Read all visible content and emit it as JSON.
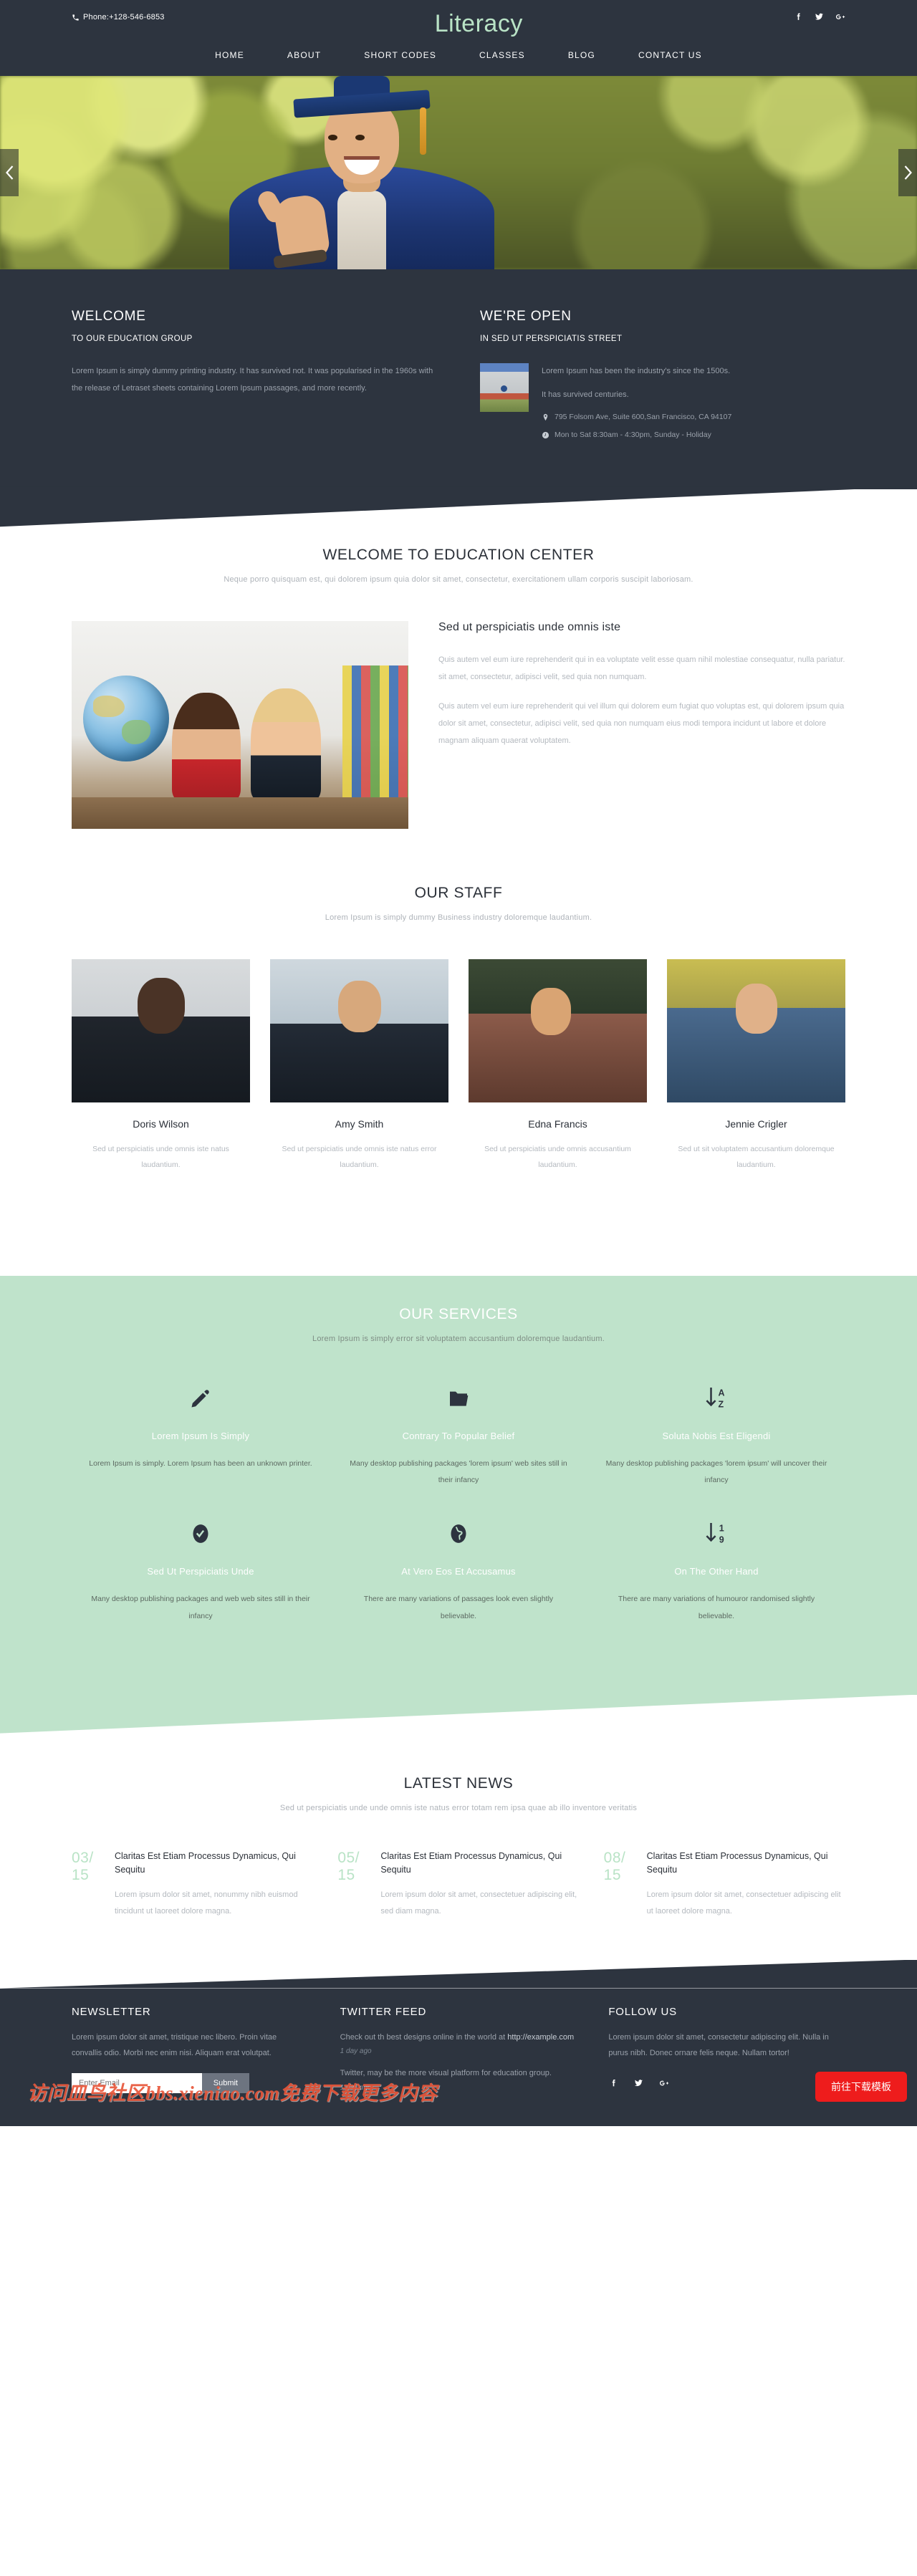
{
  "header": {
    "phone": "Phone:+128-546-6853",
    "phone_icon": "phone-icon",
    "brand": "Literacy",
    "social": [
      {
        "icon": "facebook-icon",
        "label": "Facebook"
      },
      {
        "icon": "twitter-icon",
        "label": "Twitter"
      },
      {
        "icon": "google-plus-icon",
        "label": "Google Plus"
      }
    ],
    "nav": [
      {
        "label": "HOME"
      },
      {
        "label": "ABOUT"
      },
      {
        "label": "SHORT CODES"
      },
      {
        "label": "CLASSES"
      },
      {
        "label": "BLOG"
      },
      {
        "label": "CONTACT US"
      }
    ]
  },
  "hero": {
    "prev_icon": "chevron-left-icon",
    "next_icon": "chevron-right-icon"
  },
  "welcome_band": {
    "left": {
      "title": "WELCOME",
      "subtitle": "TO OUR EDUCATION GROUP",
      "body": "Lorem Ipsum is simply dummy printing industry. It has survived not. It was popularised in the 1960s with the release of Letraset sheets containing Lorem Ipsum passages, and more recently."
    },
    "right": {
      "title": "WE'RE OPEN",
      "subtitle": "IN SED UT PERSPICIATIS STREET",
      "body1": "Lorem Ipsum has been the industry's since the 1500s.",
      "body2": "It has survived centuries.",
      "address_icon": "map-pin-icon",
      "address": "795 Folsom Ave, Suite 600,San Francisco, CA 94107",
      "hours_icon": "clock-icon",
      "hours": "Mon to Sat 8:30am - 4:30pm, Sunday - Holiday"
    }
  },
  "education": {
    "title": "WELCOME TO EDUCATION CENTER",
    "subtitle": "Neque porro quisquam est, qui dolorem ipsum quia dolor sit amet, consectetur, exercitationem ullam corporis suscipit laboriosam.",
    "heading": "Sed ut perspiciatis unde omnis iste",
    "p1": "Quis autem vel eum iure reprehenderit qui in ea voluptate velit esse quam nihil molestiae consequatur, nulla pariatur. sit amet, consectetur, adipisci velit, sed quia non numquam.",
    "p2": "Quis autem vel eum iure reprehenderit qui vel illum qui dolorem eum fugiat quo voluptas est, qui dolorem ipsum quia dolor sit amet, consectetur, adipisci velit, sed quia non numquam eius modi tempora incidunt ut labore et dolore magnam aliquam quaerat voluptatem."
  },
  "staff": {
    "title": "OUR STAFF",
    "subtitle": "Lorem Ipsum is simply dummy Business industry doloremque laudantium.",
    "members": [
      {
        "name": "Doris Wilson",
        "desc": "Sed ut perspiciatis unde omnis iste natus laudantium."
      },
      {
        "name": "Amy Smith",
        "desc": "Sed ut perspiciatis unde omnis iste natus error laudantium."
      },
      {
        "name": "Edna Francis",
        "desc": "Sed ut perspiciatis unde omnis accusantium laudantium."
      },
      {
        "name": "Jennie Crigler",
        "desc": "Sed ut sit voluptatem accusantium doloremque laudantium."
      }
    ]
  },
  "services": {
    "title": "OUR SERVICES",
    "subtitle": "Lorem Ipsum is simply error sit voluptatem accusantium doloremque laudantium.",
    "items": [
      {
        "icon": "pencil-icon",
        "title": "Lorem Ipsum Is Simply",
        "desc": "Lorem Ipsum is simply. Lorem Ipsum has been an unknown printer."
      },
      {
        "icon": "folder-icon",
        "title": "Contrary To Popular Belief",
        "desc": "Many desktop publishing packages 'lorem ipsum' web sites still in their infancy"
      },
      {
        "icon": "sort-alpha-desc-icon",
        "title": "Soluta Nobis Est Eligendi",
        "desc": "Many desktop publishing packages 'lorem ipsum' will uncover their infancy"
      },
      {
        "icon": "check-badge-icon",
        "title": "Sed Ut Perspiciatis Unde",
        "desc": "Many desktop publishing packages and web web sites still in their infancy"
      },
      {
        "icon": "globe-icon",
        "title": "At Vero Eos Et Accusamus",
        "desc": "There are many variations of passages look even slightly believable."
      },
      {
        "icon": "sort-numeric-desc-icon",
        "title": "On The Other Hand",
        "desc": "There are many variations of humouror randomised slightly believable."
      }
    ]
  },
  "news": {
    "title": "LATEST NEWS",
    "subtitle": "Sed ut perspiciatis unde unde omnis iste natus error totam rem ipsa quae ab illo inventore veritatis",
    "items": [
      {
        "day": "03/",
        "year": "15",
        "heading": "Claritas Est Etiam Processus Dynamicus, Qui Sequitu",
        "desc": "Lorem ipsum dolor sit amet, nonummy nibh euismod tincidunt ut laoreet dolore magna."
      },
      {
        "day": "05/",
        "year": "15",
        "heading": "Claritas Est Etiam Processus Dynamicus, Qui Sequitu",
        "desc": "Lorem ipsum dolor sit amet, consectetuer adipiscing elit, sed diam magna."
      },
      {
        "day": "08/",
        "year": "15",
        "heading": "Claritas Est Etiam Processus Dynamicus, Qui Sequitu",
        "desc": "Lorem ipsum dolor sit amet, consectetuer adipiscing elit ut laoreet dolore magna."
      }
    ]
  },
  "footer": {
    "newsletter": {
      "title": "NEWSLETTER",
      "body": "Lorem ipsum dolor sit amet, tristique nec libero. Proin vitae convallis odio. Morbi nec enim nisi. Aliquam erat volutpat.",
      "placeholder": "Enter Email",
      "submit": "Submit"
    },
    "twitter": {
      "title": "TWITTER FEED",
      "tweet1": "Check out th best designs online in the world at ",
      "tweet1_link": "http://example.com",
      "tweet1_ago": "1 day ago",
      "tweet2": "Twitter, may be the more visual platform for education group.",
      "tweet2_ago": "1 day ago"
    },
    "follow": {
      "title": "FOLLOW US",
      "body": "Lorem ipsum dolor sit amet, consectetur adipiscing elit. Nulla in purus nibh. Donec ornare felis neque. Nullam tortor!",
      "social": [
        {
          "icon": "facebook-icon",
          "label": "Facebook"
        },
        {
          "icon": "twitter-icon",
          "label": "Twitter"
        },
        {
          "icon": "google-plus-icon",
          "label": "Google Plus"
        }
      ]
    }
  },
  "overlay": {
    "watermark": "访问皿鸟社区bbs.xieniao.com免费下载更多内容",
    "download_button": "前往下载模板"
  },
  "colors": {
    "dark": "#2d343f",
    "mint": "#bfe3cb",
    "brand_green": "#b9e3c6",
    "muted": "#b4b9bf",
    "download_red": "#ee1c1c"
  }
}
